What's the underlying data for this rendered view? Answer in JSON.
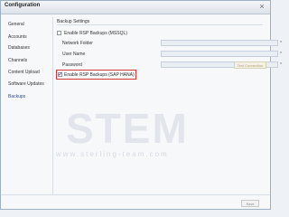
{
  "window": {
    "title": "Configuration",
    "close_glyph": "×"
  },
  "sidebar": {
    "items": [
      {
        "label": "General"
      },
      {
        "label": "Accounts"
      },
      {
        "label": "Databases"
      },
      {
        "label": "Channels"
      },
      {
        "label": "Content Upload"
      },
      {
        "label": "Software Updates"
      },
      {
        "label": "Backups"
      }
    ],
    "active_index": 6
  },
  "main": {
    "section_title": "Backup Settings",
    "mssql_checkbox": {
      "label": "Enable RSP Backups (MSSQL)",
      "checked": false
    },
    "fields": [
      {
        "label": "Network Folder",
        "value": "",
        "required_mark": "*"
      },
      {
        "label": "User Name",
        "value": "",
        "required_mark": "*"
      },
      {
        "label": "Password",
        "value": "",
        "required_mark": "*"
      }
    ],
    "test_button_label": "Test Connection",
    "hana_checkbox": {
      "label": "Enable RSP Backups (SAP HANA)",
      "checked": true
    }
  },
  "footer": {
    "save_label": "Save"
  },
  "watermark": {
    "text": "STEM",
    "url": "www.sterling-team.com"
  },
  "colors": {
    "highlight": "#d43838",
    "accent": "#2c4b91"
  }
}
